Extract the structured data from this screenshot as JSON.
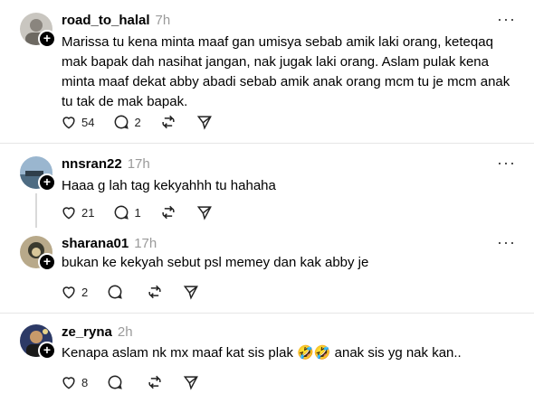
{
  "posts": [
    {
      "username": "road_to_halal",
      "time": "7h",
      "text": "Marissa tu kena minta maaf gan umisya sebab amik laki orang, keteqaq mak bapak dah nasihat jangan, nak jugak laki orang. Aslam pulak kena minta maaf dekat abby abadi sebab amik anak orang mcm tu je mcm anak tu tak de mak bapak.",
      "likes": "54",
      "replies": "2"
    },
    {
      "username": "nnsran22",
      "time": "17h",
      "text": "Haaa g lah tag kekyahhh tu hahaha",
      "likes": "21",
      "replies": "1"
    },
    {
      "username": "sharana01",
      "time": "17h",
      "text": "bukan ke kekyah sebut psl memey dan kak abby je",
      "likes": "2",
      "replies": ""
    },
    {
      "username": "ze_ryna",
      "time": "2h",
      "text": "Kenapa aslam nk mx maaf kat sis plak 🤣🤣 anak sis yg nak kan..",
      "likes": "8",
      "replies": ""
    }
  ],
  "icons": {
    "more": "more-icon",
    "like": "heart-icon",
    "reply": "comment-icon",
    "repost": "repost-icon",
    "share": "send-icon",
    "follow": "plus-icon"
  }
}
